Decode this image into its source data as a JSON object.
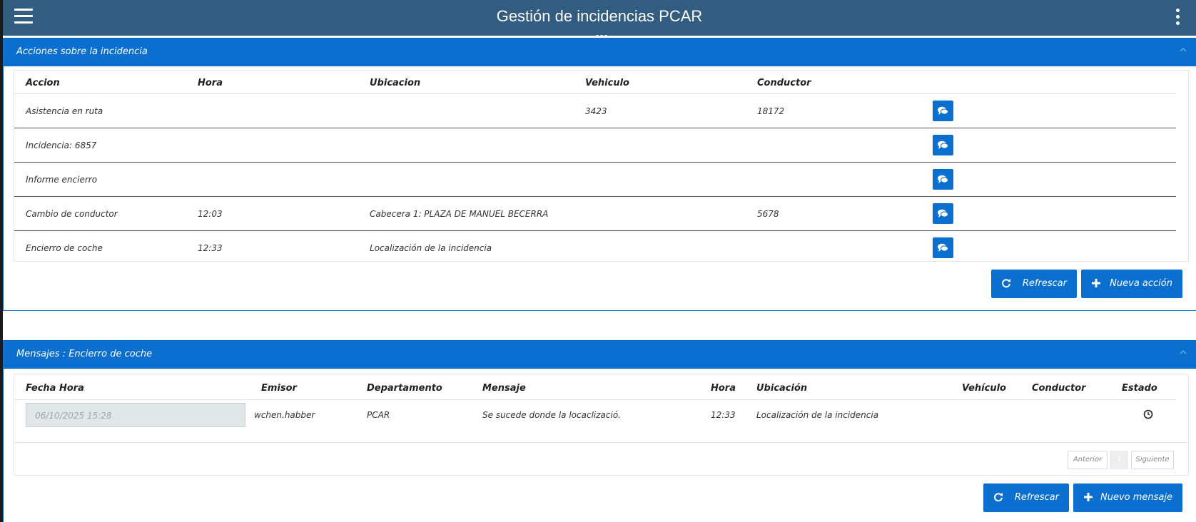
{
  "app": {
    "title": "Gestión de incidencias PCAR"
  },
  "acciones": {
    "header": "Acciones sobre la incidencia",
    "columns": [
      "Accion",
      "Hora",
      "Ubicacion",
      "Vehiculo",
      "Conductor"
    ],
    "rows": [
      {
        "accion": "Asistencia en ruta",
        "hora": "",
        "ubicacion": "",
        "vehiculo": "3423",
        "conductor": "18172"
      },
      {
        "accion": "Incidencia: 6857",
        "hora": "",
        "ubicacion": "",
        "vehiculo": "",
        "conductor": ""
      },
      {
        "accion": "Informe encierro",
        "hora": "",
        "ubicacion": "",
        "vehiculo": "",
        "conductor": ""
      },
      {
        "accion": "Cambio de conductor",
        "hora": "12:03",
        "ubicacion": "Cabecera 1: PLAZA DE MANUEL BECERRA",
        "vehiculo": "",
        "conductor": "5678"
      },
      {
        "accion": "Encierro de coche",
        "hora": "12:33",
        "ubicacion": "Localización de la incidencia",
        "vehiculo": "",
        "conductor": ""
      }
    ],
    "refresh_label": "Refrescar",
    "new_label": "Nueva acción"
  },
  "mensajes": {
    "header": "Mensajes : Encierro de coche",
    "columns": [
      "Fecha Hora",
      "Emisor",
      "Departamento",
      "Mensaje",
      "Hora",
      "Ubicación",
      "Vehículo",
      "Conductor",
      "Estado"
    ],
    "rows": [
      {
        "fecha": "06/10/2025 15:28",
        "emisor": "wchen.habber",
        "departamento": "PCAR",
        "mensaje": "Se sucede donde la locaclizació.",
        "hora": "12:33",
        "ubicacion": "Localización de la incidencia",
        "vehiculo": "",
        "conductor": ""
      }
    ],
    "pager": {
      "prev": "Anterior",
      "page": "1",
      "next": "Siguiente"
    },
    "refresh_label": "Refrescar",
    "new_label": "Nuevo mensaje"
  },
  "colors": {
    "header_bg": "#335c81",
    "accent": "#0a6fcf"
  },
  "icons": {
    "menu": "hamburger-icon",
    "more": "kebab-icon",
    "chat": "comments-icon",
    "refresh": "refresh-icon",
    "add": "plus-icon",
    "status": "clock-icon",
    "collapse": "chevron-up-icon"
  }
}
